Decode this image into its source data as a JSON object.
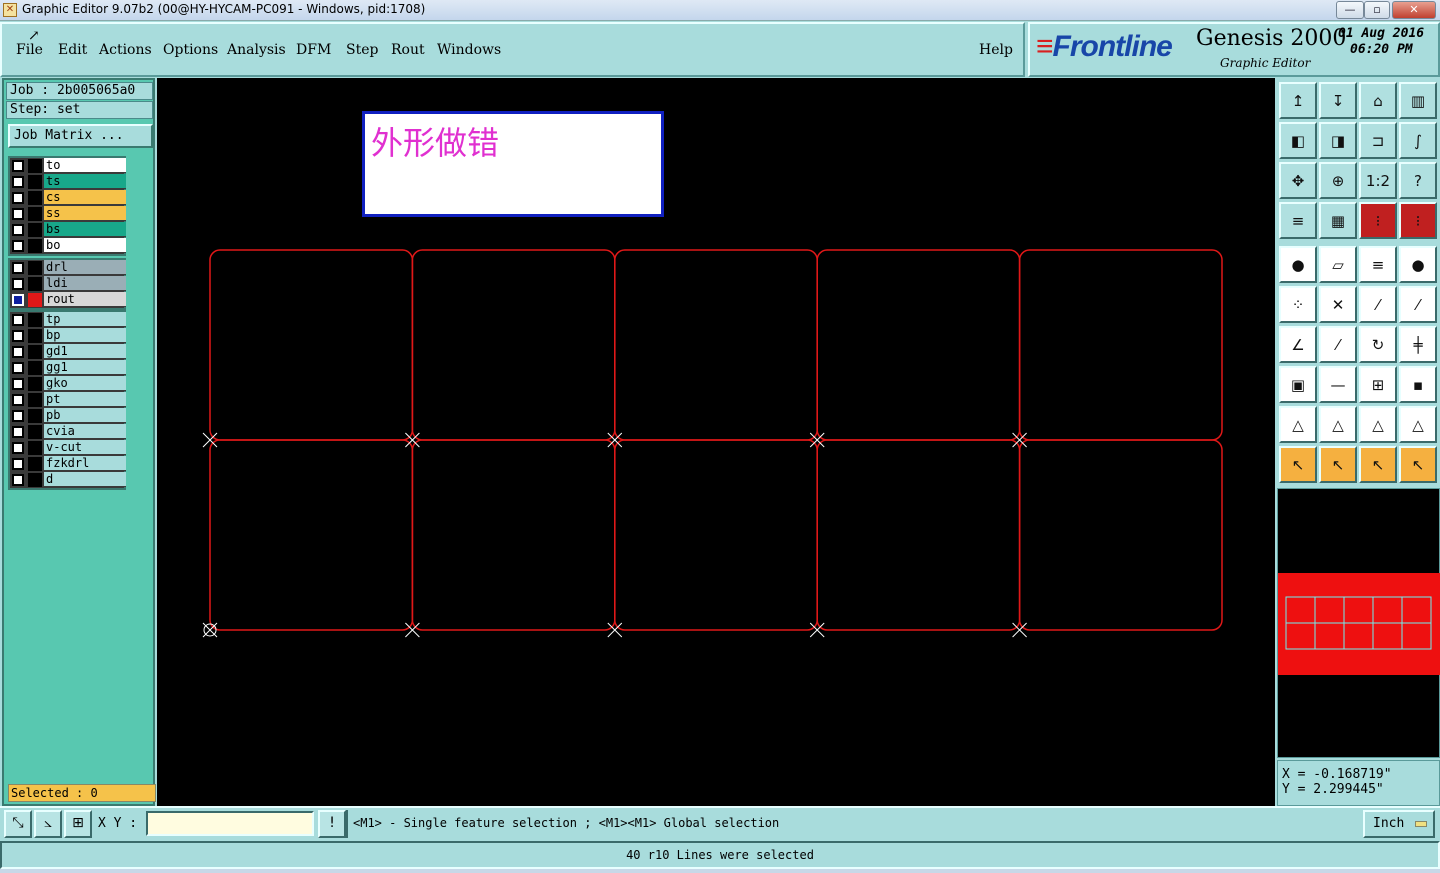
{
  "window": {
    "title": "Graphic Editor 9.07b2 (00@HY-HYCAM-PC091 - Windows, pid:1708)",
    "app_icon": "graphic-editor-icon",
    "controls": {
      "minimize": "—",
      "maximize": "▫",
      "close": "✕"
    }
  },
  "menu": {
    "items": [
      "File",
      "Edit",
      "Actions",
      "Options",
      "Analysis",
      "DFM",
      "Step",
      "Rout",
      "Windows"
    ],
    "help": "Help"
  },
  "logo": {
    "brand": "Frontline",
    "product": "Genesis 2000",
    "subtitle": "Graphic Editor",
    "date": "01 Aug 2016",
    "time": "06:20 PM"
  },
  "job": {
    "job_line": "Job : 2b005065a0",
    "step_line": "Step: set",
    "matrix_button": "Job Matrix ..."
  },
  "layer_groups": [
    [
      {
        "name": "to",
        "color": "#ffffff"
      },
      {
        "name": "ts",
        "color": "#18a88a"
      },
      {
        "name": "cs",
        "color": "#f5c24a"
      },
      {
        "name": "ss",
        "color": "#f5c24a"
      },
      {
        "name": "bs",
        "color": "#18a88a"
      },
      {
        "name": "bo",
        "color": "#ffffff"
      }
    ],
    [
      {
        "name": "drl",
        "color": "#9aaeb6"
      },
      {
        "name": "ldi",
        "color": "#9aaeb6"
      },
      {
        "name": "rout",
        "color": "#d8d8d8",
        "active": true
      }
    ],
    [
      {
        "name": "tp",
        "color": "#a8dcdc"
      },
      {
        "name": "bp",
        "color": "#a8dcdc"
      },
      {
        "name": "gd1",
        "color": "#a8dcdc"
      },
      {
        "name": "gg1",
        "color": "#a8dcdc"
      },
      {
        "name": "gko",
        "color": "#a8dcdc"
      },
      {
        "name": "pt",
        "color": "#a8dcdc"
      },
      {
        "name": "pb",
        "color": "#a8dcdc"
      },
      {
        "name": "cvia",
        "color": "#a8dcdc"
      },
      {
        "name": "v-cut",
        "color": "#a8dcdc"
      },
      {
        "name": "fzkdrl",
        "color": "#a8dcdc"
      },
      {
        "name": "d",
        "color": "#a8dcdc"
      }
    ]
  ],
  "selected": "Selected : 0",
  "canvas": {
    "note_text": "外形做错",
    "rout_color": "#e01818",
    "grid_columns": 5,
    "grid_rows": 2
  },
  "toolbar": {
    "rows": [
      [
        "↥",
        "↧",
        "⌂",
        "▥"
      ],
      [
        "◧",
        "◨",
        "⊐",
        "∫"
      ],
      [
        "✥",
        "⊕",
        "1:2",
        "?"
      ],
      [
        "≡",
        "▦",
        "⁝",
        "⁝"
      ],
      [
        "●",
        "▱",
        "≡",
        "●"
      ],
      [
        "⁘",
        "✕",
        "⁄",
        "⁄"
      ],
      [
        "∠",
        "⁄",
        "↻",
        "╪"
      ],
      [
        "▣",
        "—",
        "⊞",
        "▪"
      ],
      [
        "△",
        "△",
        "△",
        "△"
      ],
      [
        "↖",
        "↖",
        "↖",
        "↖"
      ]
    ]
  },
  "coords": {
    "x": "X = -0.168719\"",
    "y": "Y = 2.299445\""
  },
  "bottom": {
    "xy_label": "X Y :",
    "xy_value": "",
    "warn": "!",
    "hint": "<M1> - Single feature selection ; <M1><M1> Global selection",
    "unit": "Inch"
  },
  "status": "40 r10 Lines were selected"
}
